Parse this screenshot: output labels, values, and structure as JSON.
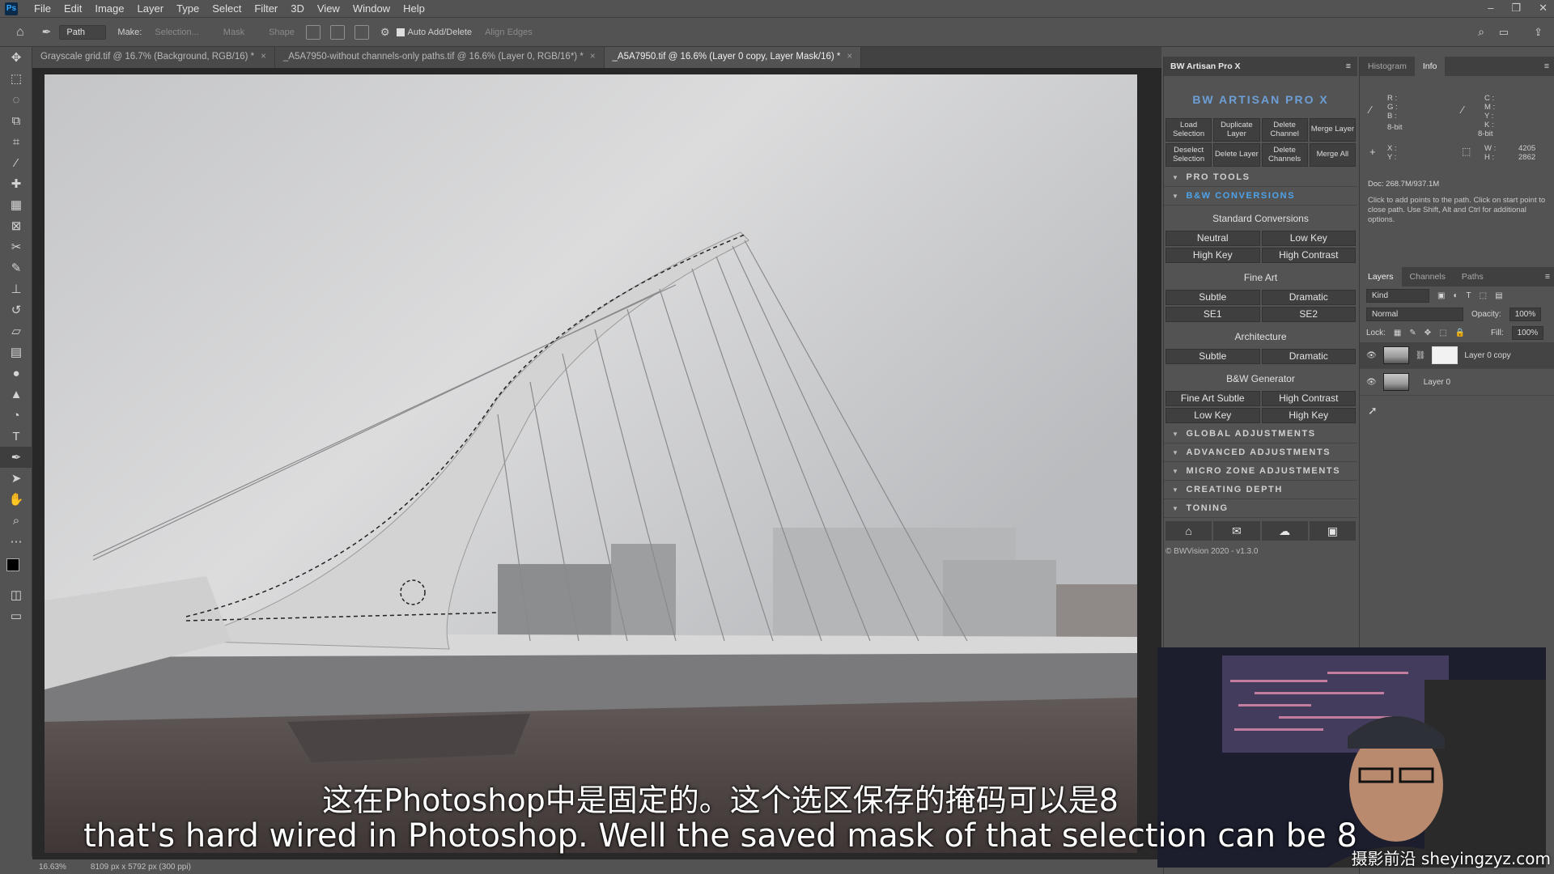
{
  "menubar": {
    "logo": "Ps",
    "items": [
      "File",
      "Edit",
      "Image",
      "Layer",
      "Type",
      "Select",
      "Filter",
      "3D",
      "View",
      "Window",
      "Help"
    ],
    "window_controls": [
      "–",
      "❐",
      "✕"
    ]
  },
  "options": {
    "mode": "Path",
    "make_label": "Make:",
    "selection": "Selection...",
    "mask": "Mask",
    "shape": "Shape",
    "auto_add_delete": "Auto Add/Delete",
    "align_edges": "Align Edges"
  },
  "tabs": [
    {
      "label": "Grayscale grid.tif @ 16.7% (Background, RGB/16) *",
      "active": false
    },
    {
      "label": "_A5A7950-without channels-only paths.tif @ 16.6% (Layer 0, RGB/16*) *",
      "active": false
    },
    {
      "label": "_A5A7950.tif @ 16.6% (Layer 0 copy, Layer Mask/16) *",
      "active": true
    }
  ],
  "status": {
    "zoom": "16.63%",
    "doc_size": "8109 px x 5792 px (300 ppi)"
  },
  "artisan": {
    "title": "BW Artisan Pro X",
    "logo_text": "BW ARTISAN PRO X",
    "top_buttons": [
      [
        "Load Selection",
        "Duplicate Layer",
        "Delete Channel",
        "Merge Layer"
      ],
      [
        "Deselect Selection",
        "Delete Layer",
        "Delete Channels",
        "Merge All"
      ]
    ],
    "pro_tools": "PRO TOOLS",
    "bw_conversions": "B&W CONVERSIONS",
    "standard_conversions": "Standard Conversions",
    "standard_buttons": [
      [
        "Neutral",
        "Low Key"
      ],
      [
        "High Key",
        "High Contrast"
      ]
    ],
    "fine_art": "Fine Art",
    "fine_art_buttons": [
      [
        "Subtle",
        "Dramatic"
      ],
      [
        "SE1",
        "SE2"
      ]
    ],
    "architecture": "Architecture",
    "architecture_buttons": [
      [
        "Subtle",
        "Dramatic"
      ]
    ],
    "generator": "B&W Generator",
    "generator_buttons": [
      [
        "Fine Art Subtle",
        "High Contrast"
      ],
      [
        "Low Key",
        "High Key"
      ]
    ],
    "sections": [
      "GLOBAL ADJUSTMENTS",
      "ADVANCED ADJUSTMENTS",
      "MICRO ZONE ADJUSTMENTS",
      "CREATING DEPTH",
      "TONING"
    ],
    "copyright": "© BWVision 2020 - v1.3.0"
  },
  "info_panel": {
    "tabs": [
      "Histogram",
      "Info"
    ],
    "rgb_labels": "R :\nG :\nB :",
    "cmyk_labels": "C :\nM :\nY :\nK :",
    "bit_depth": "8-bit",
    "xy_labels": "X :\nY :",
    "w_label": "W :",
    "h_label": "H :",
    "w_value": "4205",
    "h_value": "2862",
    "doc": "Doc: 268.7M/937.1M",
    "help": "Click to add points to the path. Click on start point to close path. Use Shift, Alt and Ctrl for additional options."
  },
  "layers_panel": {
    "tabs": [
      "Layers",
      "Channels",
      "Paths"
    ],
    "kind": "Kind",
    "blend": "Normal",
    "opacity_label": "Opacity:",
    "opacity": "100%",
    "lock_label": "Lock:",
    "fill_label": "Fill:",
    "fill": "100%",
    "layers": [
      {
        "name": "Layer 0 copy",
        "selected": true,
        "has_mask": true
      },
      {
        "name": "Layer 0",
        "selected": false,
        "has_mask": false
      }
    ]
  },
  "subtitles": {
    "cn": "这在Photoshop中是固定的。这个选区保存的掩码可以是8",
    "en": "that's hard wired in Photoshop. Well the saved mask of that selection can be 8",
    "watermark": "摄影前沿 sheyingzyz.com"
  },
  "colors": {
    "accent_blue": "#4ea3ea",
    "panel_bg": "#535353",
    "canvas_bg": "#282828"
  }
}
